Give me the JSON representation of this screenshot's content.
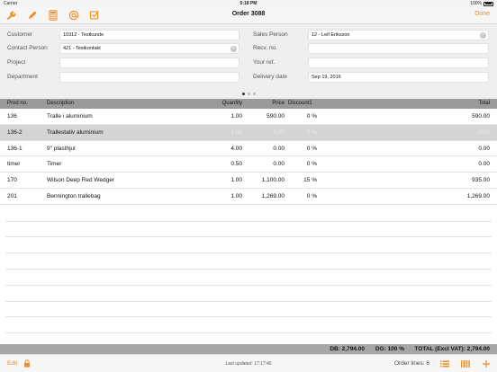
{
  "status_bar": {
    "carrier": "Carrier",
    "time": "5:18 PM",
    "battery": "100%"
  },
  "nav": {
    "title": "Order 3088",
    "done_label": "Done"
  },
  "form": {
    "customer_label": "Customer",
    "customer_value": "10312 - Testkunde",
    "contact_label": "Contact Person",
    "contact_value": "421 - Testkontakt",
    "project_label": "Project",
    "project_value": "",
    "department_label": "Department",
    "department_value": "",
    "sales_label": "Sales Person",
    "sales_value": "12 - Leif Eriksson",
    "recv_label": "Recv. no.",
    "recv_value": "",
    "your_ref_label": "Your ref.",
    "your_ref_value": "",
    "delivery_label": "Delivery date",
    "delivery_value": "Sep 19, 2016",
    "clear_glyph": "×"
  },
  "table": {
    "columns": [
      "Prod no.",
      "Description",
      "Quantity",
      "Price",
      "Discount1",
      "Total"
    ],
    "rows": [
      {
        "prod": "136",
        "desc": "Tralle i aluminium",
        "qty": "1.00",
        "price": "590.00",
        "disc": "0 %",
        "total": "590.00",
        "selected": false
      },
      {
        "prod": "136-2",
        "desc": "Trallestativ aluminium",
        "qty": "1.00",
        "price": "0.00",
        "disc": "0 %",
        "total": "0.00",
        "selected": true
      },
      {
        "prod": "136-1",
        "desc": "9\" plasthjul",
        "qty": "4.00",
        "price": "0.00",
        "disc": "0 %",
        "total": "0.00",
        "selected": false
      },
      {
        "prod": "timer",
        "desc": "Timer",
        "qty": "0.50",
        "price": "0.00",
        "disc": "0 %",
        "total": "0.00",
        "selected": false
      },
      {
        "prod": "170",
        "desc": "Wilson Deep Red Wedger",
        "qty": "1.00",
        "price": "1,100.00",
        "disc": "15 %",
        "total": "935.00",
        "selected": false
      },
      {
        "prod": "201",
        "desc": "Bennington trallebag",
        "qty": "1.00",
        "price": "1,269.00",
        "disc": "0 %",
        "total": "1,269.00",
        "selected": false
      }
    ]
  },
  "summary": {
    "db": "DB: 2,794.00",
    "dg": "DG: 100 %",
    "total": "TOTAL (Excl VAT): 2,794.00"
  },
  "toolbar": {
    "edit_label": "Edit",
    "last_updated": "Last updated: 17:17:46",
    "order_lines": "Order lines: 6"
  },
  "colors": {
    "accent": "#f08a24",
    "header_bg": "#9a9a9a",
    "summary_bg": "#a6a6a6",
    "selected_row": "#d4d4d4"
  },
  "icons": [
    "wrench-icon",
    "pencil-icon",
    "calculator-icon",
    "at-icon",
    "checklist-icon",
    "lock-icon",
    "list-icon",
    "barcode-icon",
    "plus-icon"
  ]
}
